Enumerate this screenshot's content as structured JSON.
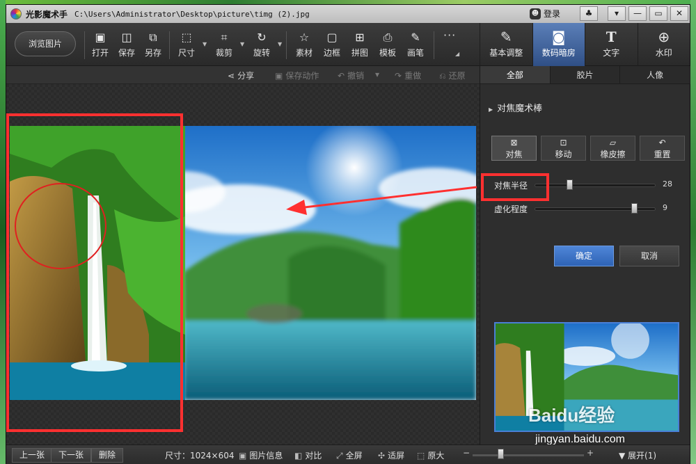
{
  "window": {
    "app_name": "光影魔术手",
    "file_path": "C:\\Users\\Administrator\\Desktop\\picture\\timg (2).jpg",
    "login_label": "登录",
    "controls": {
      "skin_icon": "shirt-icon",
      "menu_icon": "menu-icon",
      "minimize": "—",
      "maximize": "▭",
      "close": "✕"
    }
  },
  "toolbar": {
    "browse_label": "浏览图片",
    "tools": [
      {
        "label": "打开",
        "icon": "open-icon"
      },
      {
        "label": "保存",
        "icon": "save-icon"
      },
      {
        "label": "另存",
        "icon": "save-as-icon"
      },
      {
        "label": "尺寸",
        "icon": "resize-icon"
      },
      {
        "label": "裁剪",
        "icon": "crop-icon"
      },
      {
        "label": "旋转",
        "icon": "rotate-icon"
      },
      {
        "label": "素材",
        "icon": "material-icon"
      },
      {
        "label": "边框",
        "icon": "border-icon"
      },
      {
        "label": "拼图",
        "icon": "collage-icon"
      },
      {
        "label": "模板",
        "icon": "template-icon"
      },
      {
        "label": "画笔",
        "icon": "brush-icon"
      }
    ],
    "more_label": "···",
    "modes": [
      {
        "label": "基本调整",
        "icon": "adjust-icon"
      },
      {
        "label": "数码暗房",
        "icon": "camera-icon",
        "active": true
      },
      {
        "label": "文字",
        "icon": "text-icon"
      },
      {
        "label": "水印",
        "icon": "watermark-icon"
      }
    ]
  },
  "actions": {
    "share": "分享",
    "save_action": "保存动作",
    "undo": "撤销",
    "redo": "重做",
    "restore": "还原"
  },
  "panel": {
    "tabs": [
      "全部",
      "胶片",
      "人像"
    ],
    "section_title": "对焦魔术棒",
    "tool_buttons": [
      "对焦",
      "移动",
      "橡皮擦",
      "重置"
    ],
    "sliders": [
      {
        "label": "对焦半径",
        "value": "28",
        "fraction": 0.29
      },
      {
        "label": "虚化程度",
        "value": "9",
        "fraction": 0.82
      }
    ],
    "ok": "确定",
    "cancel": "取消"
  },
  "status": {
    "prev": "上一张",
    "next": "下一张",
    "delete": "删除",
    "size": "尺寸：1024×604",
    "info": "图片信息",
    "compare": "对比",
    "fullscreen": "全屏",
    "fit": "适屏",
    "original": "原大",
    "zoom_fraction": 0.25,
    "expand": "展开(1)"
  },
  "watermark": {
    "logo": "Baidu经验",
    "url": "jingyan.baidu.com"
  },
  "colors": {
    "accent": "#2f63b5",
    "annotation": "#ff3030",
    "active_tab": "#3c68a8"
  }
}
